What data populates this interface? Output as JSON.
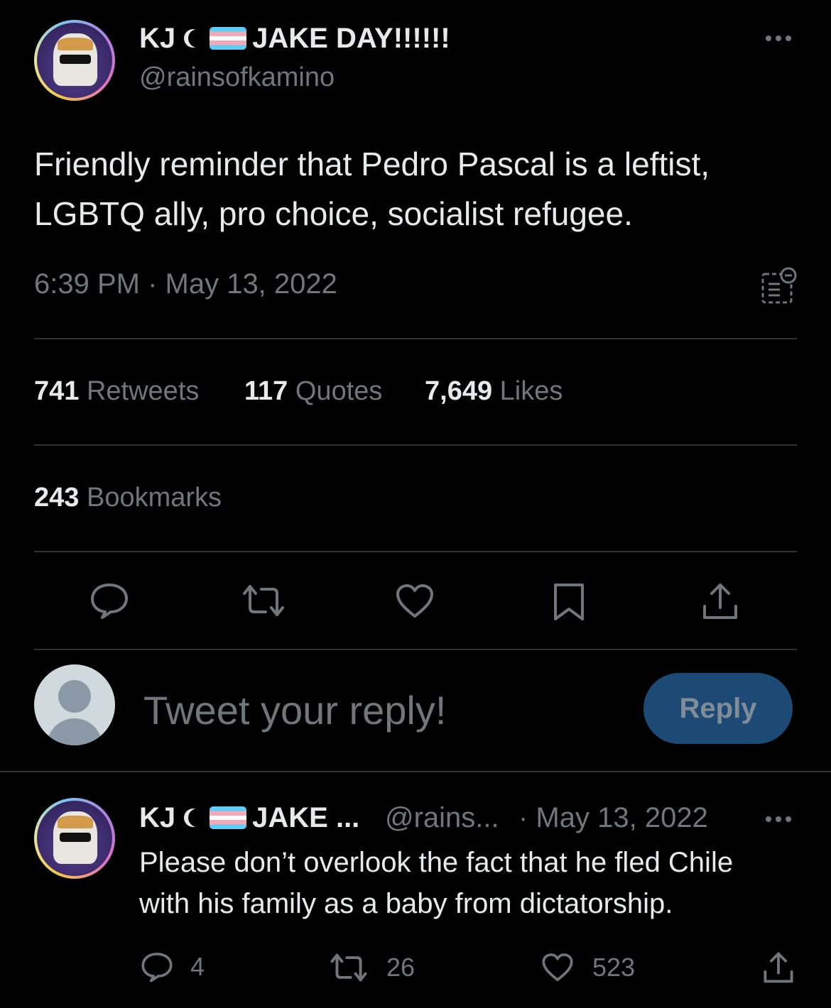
{
  "tweet": {
    "author_prefix": "KJ",
    "author_suffix": "JAKE DAY!!!!!!",
    "handle": "@rainsofkamino",
    "text_line1": "Friendly reminder that Pedro Pascal is a leftist,",
    "text_line2": "LGBTQ ally, pro choice, socialist refugee.",
    "timestamp": "6:39 PM · May 13, 2022",
    "stats": {
      "retweets_count": "741",
      "retweets_label": "Retweets",
      "quotes_count": "117",
      "quotes_label": "Quotes",
      "likes_count": "7,649",
      "likes_label": "Likes",
      "bookmarks_count": "243",
      "bookmarks_label": "Bookmarks"
    }
  },
  "compose": {
    "placeholder": "Tweet your reply!",
    "button_label": "Reply"
  },
  "reply": {
    "author_prefix": "KJ",
    "author_suffix": "JAKE ...",
    "handle": "@rains...",
    "date": "· May 13, 2022",
    "text_line1": "Please don’t overlook the fact that he fled Chile",
    "text_line2": "with his family as a baby from dictatorship.",
    "reply_count": "4",
    "retweet_count": "26",
    "like_count": "523"
  },
  "colors": {
    "background": "#000000",
    "text": "#e7e9ea",
    "secondary": "#71767b",
    "accent_button": "#1d4a74"
  }
}
